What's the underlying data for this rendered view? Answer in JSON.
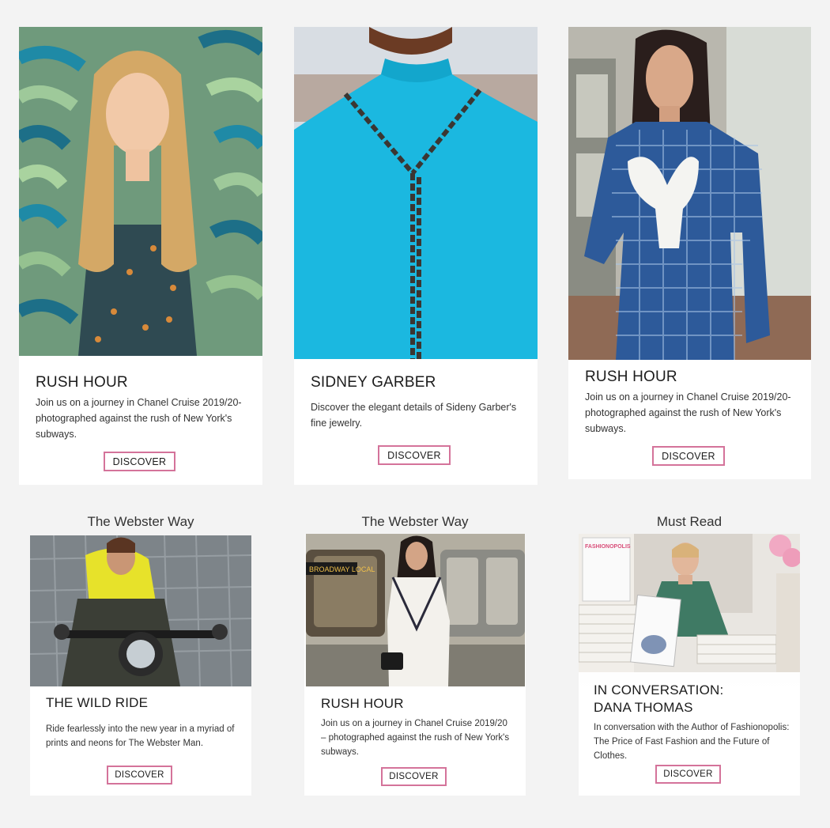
{
  "top_cards": [
    {
      "title": "RUSH HOUR",
      "description": "Join us on a journey in Chanel Cruise 2019/20-photographed against the rush of New York's subways.",
      "button_label": "DISCOVER"
    },
    {
      "title": "SIDNEY GARBER",
      "description": "Discover the elegant details of Sideny Garber's fine jewelry.",
      "button_label": "DISCOVER"
    },
    {
      "title": "RUSH HOUR",
      "description": "Join us on a journey in Chanel Cruise 2019/20-photographed against the rush of New York's subways.",
      "button_label": "DISCOVER"
    }
  ],
  "bottom_cards": [
    {
      "heading": "The Webster Way",
      "title": "THE WILD RIDE",
      "description": "Ride fearlessly into the new year in a myriad of prints and neons for The Webster Man.",
      "button_label": "DISCOVER"
    },
    {
      "heading": "The Webster Way",
      "title": "RUSH HOUR",
      "description": "Join us on a journey in Chanel Cruise 2019/20 – photographed against the rush of New York's subways.",
      "button_label": "DISCOVER"
    },
    {
      "heading": "Must Read",
      "title_line1": "IN CONVERSATION:",
      "title_line2": "DANA THOMAS",
      "description": "In conversation with the Author of Fashionopolis: The Price of Fast Fashion and the Future of Clothes.",
      "button_label": "DISCOVER"
    }
  ],
  "photo_text": {
    "subway_sign": "BROADWAY LOCAL",
    "book_title": "FASHIONOPOLIS"
  },
  "colors": {
    "page_background": "#f3f3f3",
    "button_border": "#d4739a"
  }
}
